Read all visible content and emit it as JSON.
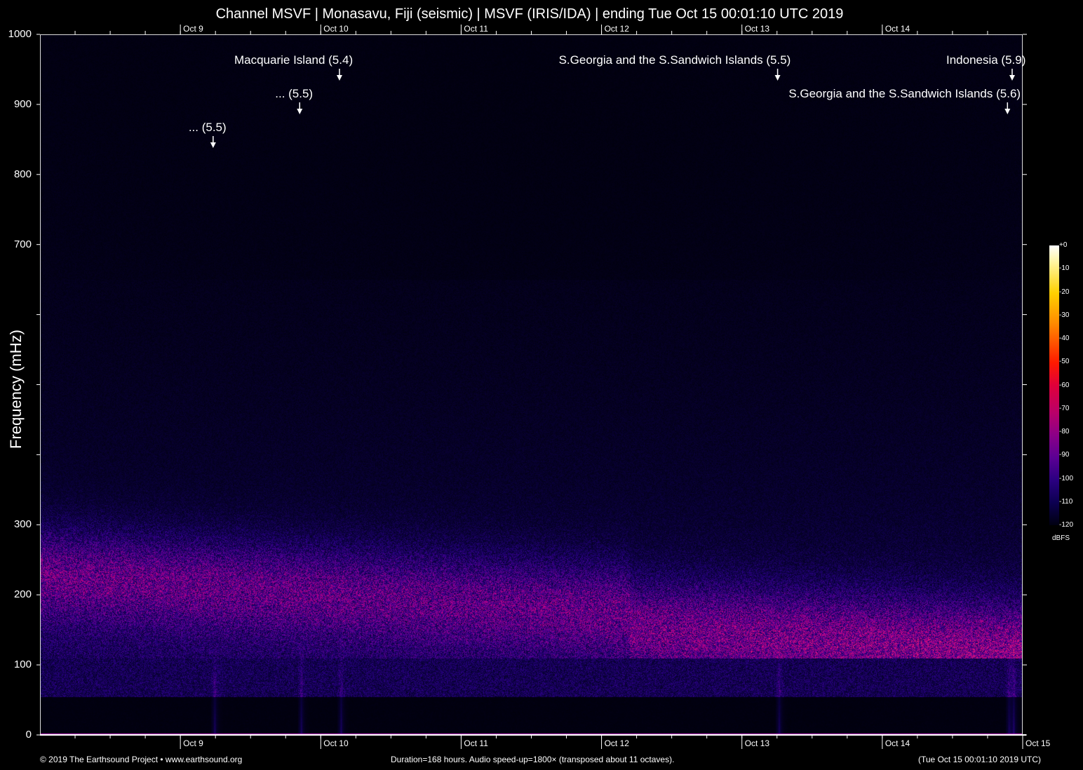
{
  "chart_data": {
    "type": "heatmap",
    "title": "Channel MSVF | Monasavu, Fiji (seismic) | MSVF (IRIS/IDA) | ending Tue Oct 15 00:01:10 UTC 2019",
    "ylabel": "Frequency (mHz)",
    "ylim": [
      0,
      1000
    ],
    "y_ticks": [
      0,
      100,
      200,
      300,
      400,
      500,
      600,
      700,
      800,
      900,
      1000
    ],
    "y_tick_labels": [
      "0",
      "100",
      "200",
      "300",
      "",
      "",
      "",
      "700",
      "800",
      "900",
      "1000"
    ],
    "x_unit": "hours from start",
    "xlim": [
      0,
      168
    ],
    "x_day_ticks": [
      {
        "label": "Oct  9",
        "hours": 24
      },
      {
        "label": "Oct 10",
        "hours": 48
      },
      {
        "label": "Oct 11",
        "hours": 72
      },
      {
        "label": "Oct 12",
        "hours": 96
      },
      {
        "label": "Oct 13",
        "hours": 120
      },
      {
        "label": "Oct 14",
        "hours": 144
      }
    ],
    "x_end_label": "Oct 15",
    "minor_tick_hours": 6,
    "colorbar": {
      "unit": "dBFS",
      "range": [
        -120,
        0
      ],
      "tick_labels": [
        "+0",
        "-10",
        "-20",
        "-30",
        "-40",
        "-50",
        "-60",
        "-70",
        "-80",
        "-90",
        "-100",
        "-110",
        "-120"
      ]
    },
    "events": [
      {
        "label": "... (5.5)",
        "hours": 29.6,
        "row": 3
      },
      {
        "label": "... (5.5)",
        "hours": 44.4,
        "row": 2
      },
      {
        "label": "Macquarie Island (5.4)",
        "hours": 51.2,
        "row": 1
      },
      {
        "label": "S.Georgia and the S.Sandwich Islands (5.5)",
        "hours": 126.1,
        "row": 1
      },
      {
        "label": "S.Georgia and the S.Sandwich Islands (5.6)",
        "hours": 165.4,
        "row": 2
      },
      {
        "label": "Indonesia (5.9)",
        "hours": 166.2,
        "row": 1
      }
    ],
    "colors": {
      "low": "#000010",
      "mid": "#2a0080",
      "high": "#b8006a",
      "axis": "#ffffff",
      "arrow": "#ffffff"
    }
  },
  "footer": {
    "left": "© 2019 The Earthsound Project • www.earthsound.org",
    "center": "Duration=168 hours. Audio speed-up=1800× (transposed about 11 octaves).",
    "right": "(Tue Oct 15 00:01:10 2019 UTC)"
  }
}
